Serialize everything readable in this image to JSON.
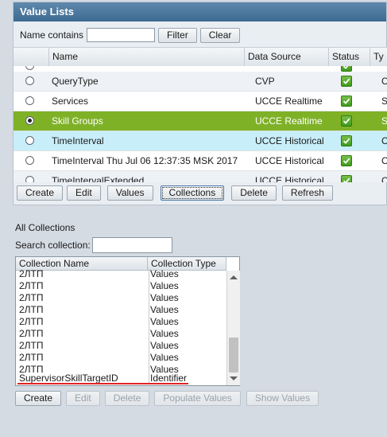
{
  "panel": {
    "title": "Value Lists",
    "filter_label": "Name contains",
    "filter_value": "",
    "filter_button": "Filter",
    "clear_button": "Clear"
  },
  "grid": {
    "columns": [
      "Name",
      "Data Source",
      "Status",
      "Ty"
    ],
    "rows": [
      {
        "name": "",
        "source": "",
        "status": true,
        "type": "",
        "radio": false,
        "state": "partial"
      },
      {
        "name": "QueryType",
        "source": "CVP",
        "status": true,
        "type": "C",
        "radio": false,
        "state": "alt"
      },
      {
        "name": "Services",
        "source": "UCCE Realtime",
        "status": true,
        "type": "S",
        "radio": false,
        "state": "normal"
      },
      {
        "name": "Skill Groups",
        "source": "UCCE Realtime",
        "status": true,
        "type": "S",
        "radio": true,
        "state": "selected"
      },
      {
        "name": "TimeInterval",
        "source": "UCCE Historical",
        "status": true,
        "type": "C",
        "radio": false,
        "state": "hover"
      },
      {
        "name": "TimeInterval Thu Jul 06 12:37:35 MSK 2017",
        "source": "UCCE Historical",
        "status": true,
        "type": "C",
        "radio": false,
        "state": "normal"
      },
      {
        "name": "TimeIntervalExtended",
        "source": "UCCE Historical",
        "status": true,
        "type": "C",
        "radio": false,
        "state": "alt"
      }
    ]
  },
  "toolbar": {
    "create": "Create",
    "edit": "Edit",
    "values": "Values",
    "collections": "Collections",
    "delete": "Delete",
    "refresh": "Refresh"
  },
  "collections": {
    "section_title": "All Collections",
    "search_label": "Search collection:",
    "search_value": "",
    "col_name": "Collection Name",
    "col_type": "Collection Type",
    "items": [
      {
        "name": "2ЛТП",
        "type": "Values"
      },
      {
        "name": "2ЛТП",
        "type": "Values"
      },
      {
        "name": "2ЛТП",
        "type": "Values"
      },
      {
        "name": "2ЛТП",
        "type": "Values"
      },
      {
        "name": "2ЛТП",
        "type": "Values"
      },
      {
        "name": "2ЛТП",
        "type": "Values"
      },
      {
        "name": "2ЛТП",
        "type": "Values"
      },
      {
        "name": "2ЛТП",
        "type": "Values"
      },
      {
        "name": "2ЛТП",
        "type": "Values"
      },
      {
        "name": "SupervisorSkillTargetID",
        "type": "Identifier"
      }
    ]
  },
  "bottom_toolbar": {
    "create": "Create",
    "edit": "Edit",
    "delete": "Delete",
    "populate": "Populate Values",
    "show": "Show Values"
  },
  "colors": {
    "title_bar": "#3d6a91",
    "selected_row": "#7fb127",
    "hover_row": "#c8eefa",
    "underline": "#e02424"
  }
}
